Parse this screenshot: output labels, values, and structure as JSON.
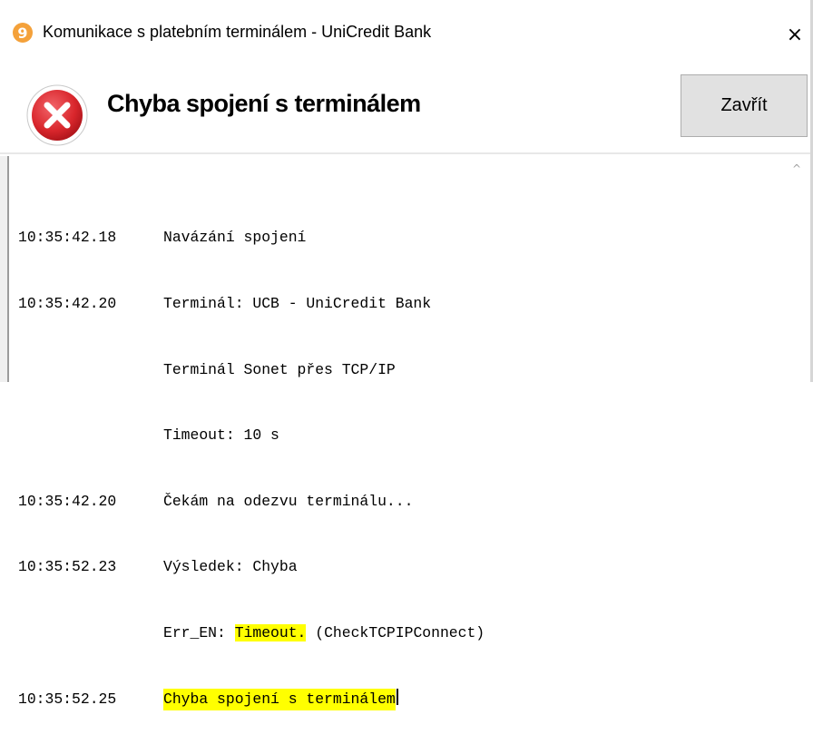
{
  "window": {
    "title": "Komunikace s platebním terminálem - UniCredit Bank",
    "app_icon_glyph": "9",
    "close_glyph": "×"
  },
  "header": {
    "icon": "error-icon",
    "heading": "Chyba spojení s terminálem",
    "close_button_label": "Zavřít"
  },
  "log": [
    {
      "time": "10:35:42.18",
      "text": "Navázání spojení"
    },
    {
      "time": "10:35:42.20",
      "text": "Terminál: UCB - UniCredit Bank"
    },
    {
      "time": "",
      "text": "Terminál Sonet přes TCP/IP"
    },
    {
      "time": "",
      "text": "Timeout: 10 s"
    },
    {
      "time": "10:35:42.20",
      "text": "Čekám na odezvu terminálu..."
    },
    {
      "time": "10:35:52.23",
      "text": "Výsledek: Chyba"
    },
    {
      "time": "",
      "text_prefix": "Err_EN: ",
      "text_highlight": "Timeout.",
      "text_suffix": " (CheckTCPIPConnect)"
    },
    {
      "time": "10:35:52.25",
      "text": "Chyba spojení s terminálem"
    }
  ],
  "colors": {
    "highlight": "#ffff00",
    "app_icon": "#f4a13a",
    "error_red": "#d9262c"
  },
  "scroll_up_glyph": "^"
}
